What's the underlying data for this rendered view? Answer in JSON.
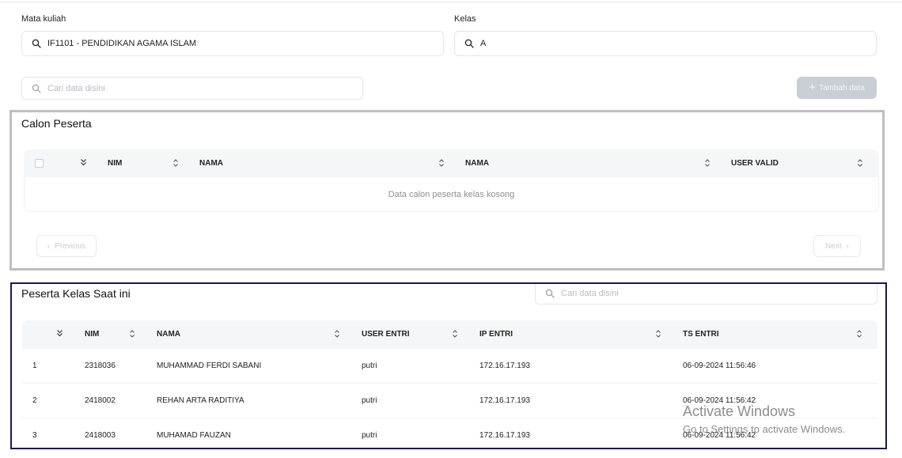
{
  "filters": {
    "mata_kuliah": {
      "label": "Mata kuliah",
      "value": "IF1101 - PENDIDIKAN AGAMA ISLAM"
    },
    "kelas": {
      "label": "Kelas",
      "value": "A"
    }
  },
  "search": {
    "placeholder": "Cari data disini"
  },
  "add_button": {
    "label": "Tambah data"
  },
  "calon_peserta": {
    "title": "Calon Peserta",
    "columns": [
      "NIM",
      "NAMA",
      "NAMA",
      "USER VALID"
    ],
    "empty_message": "Data calon peserta kelas kosong",
    "pagination": {
      "previous": "Previous",
      "next": "Next"
    }
  },
  "peserta_kelas": {
    "title": "Peserta Kelas Saat ini",
    "search_placeholder": "Cari data disini",
    "columns": [
      "NIM",
      "NAMA",
      "USER ENTRI",
      "IP ENTRI",
      "TS ENTRI"
    ],
    "rows": [
      {
        "no": "1",
        "nim": "2318036",
        "nama": "MUHAMMAD FERDI SABANI",
        "user_entri": "putri",
        "ip_entri": "172.16.17.193",
        "ts_entri": "06-09-2024 11:56:46"
      },
      {
        "no": "2",
        "nim": "2418002",
        "nama": "REHAN ARTA RADITIYA",
        "user_entri": "putri",
        "ip_entri": "172.16.17.193",
        "ts_entri": "06-09-2024 11:56:42"
      },
      {
        "no": "3",
        "nim": "2418003",
        "nama": "MUHAMAD FAUZAN",
        "user_entri": "putri",
        "ip_entri": "172.16.17.193",
        "ts_entri": "06-09-2024 11:56:42"
      }
    ]
  },
  "os_watermark": {
    "line1": "Activate Windows",
    "line2": "Go to Settings to activate Windows."
  }
}
